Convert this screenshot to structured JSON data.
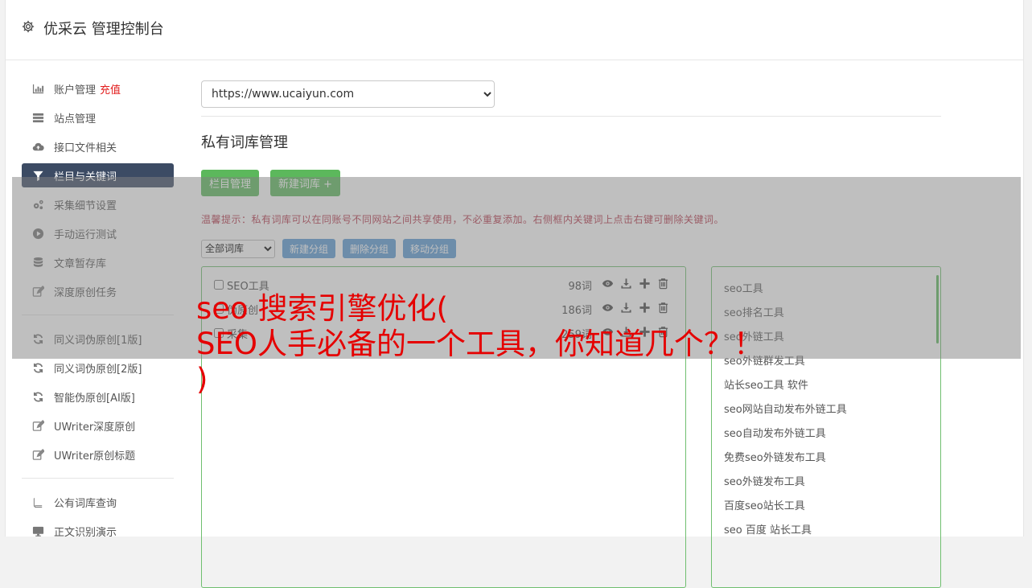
{
  "header": {
    "title": "优采云 管理控制台"
  },
  "sidebar": {
    "items": [
      {
        "label": "账户管理",
        "badge": "充值",
        "icon": "bar-chart-icon"
      },
      {
        "label": "站点管理",
        "icon": "server-icon"
      },
      {
        "label": "接口文件相关",
        "icon": "cloud-upload-icon"
      },
      {
        "label": "栏目与关键词",
        "icon": "filter-icon",
        "active": true
      },
      {
        "label": "采集细节设置",
        "icon": "gears-icon"
      },
      {
        "label": "手动运行测试",
        "icon": "play-circle-icon"
      },
      {
        "label": "文章暂存库",
        "icon": "database-icon"
      },
      {
        "label": "深度原创任务",
        "icon": "edit-icon"
      },
      {
        "label": "同义词伪原创[1版]",
        "icon": "refresh-icon"
      },
      {
        "label": "同义词伪原创[2版]",
        "icon": "refresh-icon"
      },
      {
        "label": "智能伪原创[AI版]",
        "icon": "refresh-icon"
      },
      {
        "label": "UWriter深度原创",
        "icon": "edit-icon"
      },
      {
        "label": "UWriter原创标题",
        "icon": "edit-icon"
      },
      {
        "label": "公有词库查询",
        "icon": "book-icon"
      },
      {
        "label": "正文识别演示",
        "icon": "monitor-icon"
      }
    ]
  },
  "main": {
    "site_select_value": "https://www.ucaiyun.com",
    "page_title": "私有词库管理",
    "btn_column_manage": "栏目管理",
    "btn_new_lib": "新建词库 +",
    "tip": "温馨提示：私有词库可以在同账号不同网站之间共享使用，不必重复添加。右侧框内关键词上点击右键可删除关键词。",
    "lib_select_value": "全部词库",
    "btn_new_group": "新建分组",
    "btn_delete_group": "删除分组",
    "btn_move_group": "移动分组",
    "groups": [
      {
        "name": "SEO工具",
        "count": "98词"
      },
      {
        "name": "伪原创",
        "count": "186词"
      },
      {
        "name": "采集",
        "count": "259词"
      }
    ],
    "keywords": [
      "seo工具",
      "seo排名工具",
      "seo外链工具",
      "seo外链群发工具",
      "站长seo工具 软件",
      "seo网站自动发布外链工具",
      "seo自动发布外链工具",
      "免费seo外链发布工具",
      "seo外链发布工具",
      "百度seo站长工具",
      "seo 百度 站长工具"
    ]
  },
  "headline": {
    "line1": "seo 搜索引擎优化(",
    "line2": "SEO人手必备的一个工具，你知道几个？！",
    "line3": ")"
  },
  "colors": {
    "active_nav": "#3c4b64",
    "green": "#5cb85c",
    "blue": "#5b9bd5",
    "tip": "#b5374a",
    "headline": "#e50000"
  }
}
